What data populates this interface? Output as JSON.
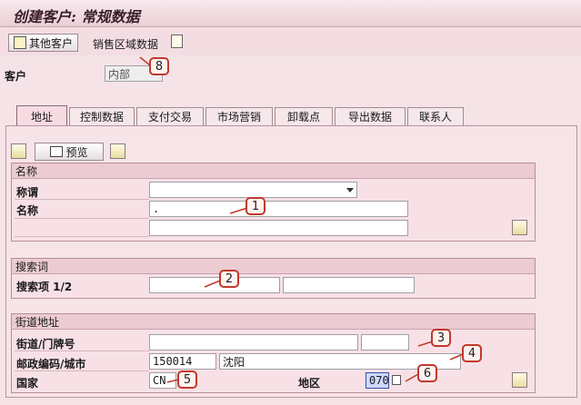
{
  "window": {
    "title": "创建客户: 常规数据"
  },
  "toolbar": {
    "other_customer_label": "其他客户",
    "sales_area_label": "销售区域数据"
  },
  "header": {
    "customer_label": "客户",
    "customer_value": "内部"
  },
  "tabs": [
    {
      "label": "地址"
    },
    {
      "label": "控制数据"
    },
    {
      "label": "支付交易"
    },
    {
      "label": "市场营销"
    },
    {
      "label": "卸载点"
    },
    {
      "label": "导出数据"
    },
    {
      "label": "联系人"
    }
  ],
  "panel_toolbar": {
    "preview_label": "预览"
  },
  "name_group": {
    "title": "名称",
    "salutation_label": "称谓",
    "name_label": "名称",
    "name_value": "."
  },
  "search_group": {
    "title": "搜索词",
    "search_label": "搜索项 1/2"
  },
  "street_group": {
    "title": "街道地址",
    "street_label": "街道/门牌号",
    "postal_city_label": "邮政编码/城市",
    "postal_value": "150014",
    "city_value": "沈阳",
    "country_label": "国家",
    "country_value": "CN",
    "region_label": "地区",
    "region_value": "070"
  },
  "callouts": [
    "1",
    "2",
    "3",
    "4",
    "5",
    "6",
    "8"
  ],
  "colors": {
    "accent": "#c0392b",
    "background": "#f5e3e7"
  }
}
